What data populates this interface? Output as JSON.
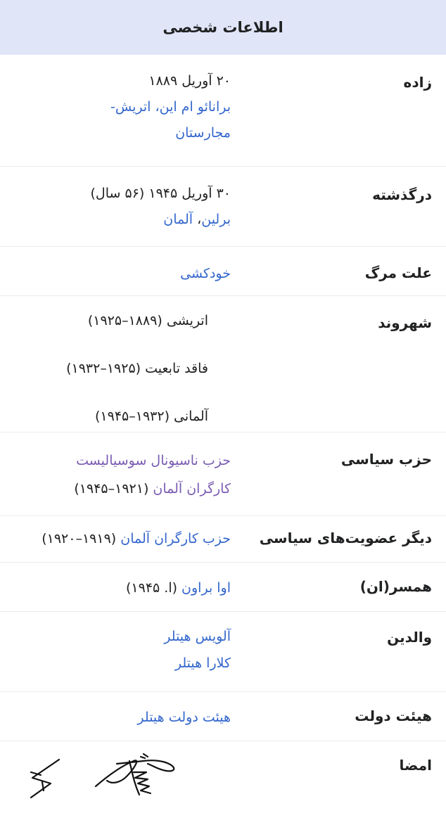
{
  "header": {
    "title": "اطلاعات شخصی"
  },
  "born": {
    "label": "زاده",
    "date": "۲۰ آوریل ۱۸۸۹",
    "place_line1": "برانائو ام این، اتریش-",
    "place_line2": "مجارستان"
  },
  "died": {
    "label": "درگذشته",
    "date": "۳۰ آوریل ۱۹۴۵ (۵۶ سال)",
    "place_city": "برلین",
    "place_sep": "، ",
    "place_country": "آلمان"
  },
  "cause_of_death": {
    "label": "علت مرگ",
    "value": "خودکشی"
  },
  "citizenship": {
    "label": "شهروند",
    "items": [
      "اتریشی (۱۸۸۹–۱۹۲۵)",
      "فاقد تابعیت (۱۹۲۵–۱۹۳۲)",
      "آلمانی (۱۹۳۲–۱۹۴۵)"
    ]
  },
  "political_party": {
    "label": "حزب سیاسی",
    "line1": "حزب ناسیونال سوسیالیست",
    "line2_link": "کارگران آلمان",
    "line2_years": " (۱۹۲۱–۱۹۴۵)"
  },
  "other_party": {
    "label": "دیگر عضویت‌های سیاسی",
    "link": "حزب کارگران آلمان",
    "years": " (۱۹۱۹–۱۹۲۰)"
  },
  "spouse": {
    "label": "همسر(ان)",
    "link": "اوا براون",
    "years": " (ا. ۱۹۴۵)"
  },
  "parents": {
    "label": "والدین",
    "father": "آلویس هیتلر",
    "mother": "کلارا هیتلر"
  },
  "cabinet": {
    "label": "هیئت دولت",
    "value": "هیئت دولت هیتلر"
  },
  "signature": {
    "label": "امضا"
  },
  "colors": {
    "header_bg": "#e1e5f8",
    "link": "#3366cc",
    "visited_link": "#795cb2",
    "text": "#202122",
    "divider": "#eaecf0"
  }
}
